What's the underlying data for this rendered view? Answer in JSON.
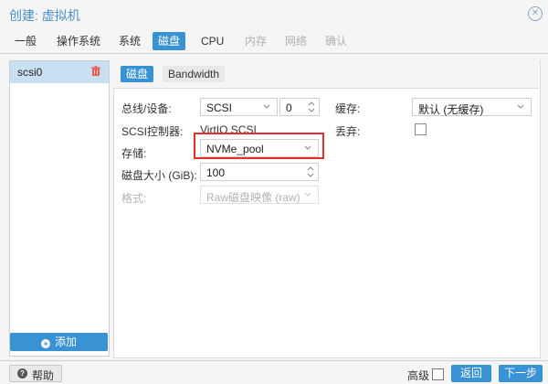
{
  "window": {
    "title": "创建: 虚拟机",
    "close_icon": "close-icon"
  },
  "tabs": [
    {
      "label": "一般",
      "state": "normal"
    },
    {
      "label": "操作系统",
      "state": "normal"
    },
    {
      "label": "系统",
      "state": "normal"
    },
    {
      "label": "磁盘",
      "state": "active"
    },
    {
      "label": "CPU",
      "state": "normal"
    },
    {
      "label": "内存",
      "state": "disabled"
    },
    {
      "label": "网络",
      "state": "disabled"
    },
    {
      "label": "确认",
      "state": "disabled"
    }
  ],
  "disk_list": {
    "items": [
      {
        "label": "scsi0",
        "icon": "trash-icon"
      }
    ],
    "add_label": "添加"
  },
  "subtabs": [
    {
      "label": "磁盘",
      "state": "active"
    },
    {
      "label": "Bandwidth",
      "state": "normal"
    }
  ],
  "form": {
    "bus_label": "总线/设备:",
    "bus_value": "SCSI",
    "device_value": "0",
    "controller_label": "SCSI控制器:",
    "controller_value": "VirtIO SCSI",
    "storage_label": "存储:",
    "storage_value": "NVMe_pool",
    "size_label": "磁盘大小 (GiB):",
    "size_value": "100",
    "format_label": "格式:",
    "format_value": "Raw磁盘映像 (raw)",
    "cache_label": "缓存:",
    "cache_value": "默认 (无缓存)",
    "discard_label": "丢弃:",
    "discard_checked": false
  },
  "footer": {
    "help_label": "帮助",
    "advanced_label": "高级",
    "advanced_checked": false,
    "back_label": "返回",
    "next_label": "下一步"
  },
  "colors": {
    "accent": "#3892d4",
    "highlight": "#e03030",
    "title": "#4a90c8"
  }
}
